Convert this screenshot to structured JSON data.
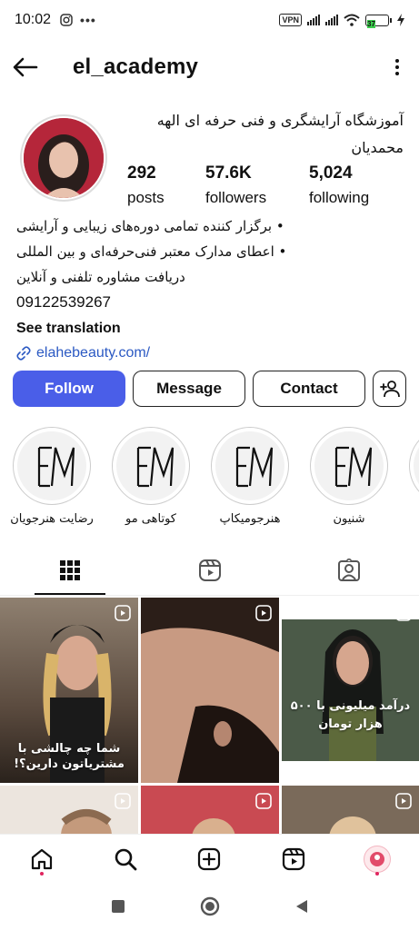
{
  "status_bar": {
    "time": "10:02",
    "vpn": "VPN",
    "battery_level": "37",
    "icons": [
      "instagram-icon",
      "more-dots-icon",
      "vpn-icon",
      "signal-icon",
      "signal-icon",
      "wifi-icon",
      "battery-icon",
      "charging-icon"
    ]
  },
  "header": {
    "username": "el_academy",
    "icons": [
      "back-arrow-icon",
      "more-vertical-icon"
    ]
  },
  "profile": {
    "name_line1": "آموزشگاه آرایشگری و فنی حرفه ای الهه",
    "name_line2": "محمدیان",
    "avatar_color": "#b5263a",
    "stats": [
      {
        "value": "292",
        "label": "posts"
      },
      {
        "value": "57.6K",
        "label": "followers"
      },
      {
        "value": "5,024",
        "label": "following"
      }
    ]
  },
  "bio": {
    "lines": [
      "• برگزار کننده تمامی دوره‌های زیبایی و آرایشی",
      "• اعطای مدارک معتبر فنی‌حرفه‌ای و بین المللی",
      "دریافت مشاوره تلفنی و آنلاین"
    ],
    "phone": "09122539267",
    "see_translation": "See translation",
    "link": "elahebeauty.com/",
    "link_color": "#2b59c3"
  },
  "actions": {
    "follow": "Follow",
    "message": "Message",
    "contact": "Contact",
    "follow_color": "#4a5ee8"
  },
  "highlights": [
    {
      "label": "رضایت هنرجویان"
    },
    {
      "label": "کوتاهی مو"
    },
    {
      "label": "هنرجومیکاپ"
    },
    {
      "label": "شنیون"
    }
  ],
  "tabs": [
    "grid-icon",
    "reels-icon",
    "tagged-icon"
  ],
  "posts": [
    {
      "caption": "شما چه چالشی با مشتریاتون دارین؟!",
      "bg": "#6b5a4a"
    },
    {
      "caption": "",
      "bg": "#3a2a22"
    },
    {
      "caption": "درآمد میلیونی با ۵۰۰ هزار تومان",
      "bg": "#2c3a2a"
    },
    {
      "caption": "",
      "bg": "#e9e2db"
    },
    {
      "caption": "",
      "bg": "#c94a52"
    },
    {
      "caption": "",
      "bg": "#8a7a6a"
    }
  ],
  "bottom_nav": [
    "home-icon",
    "search-icon",
    "create-icon",
    "reels-icon",
    "profile-avatar-icon"
  ],
  "android_nav": [
    "recents-square-icon",
    "home-circle-icon",
    "back-triangle-icon"
  ]
}
